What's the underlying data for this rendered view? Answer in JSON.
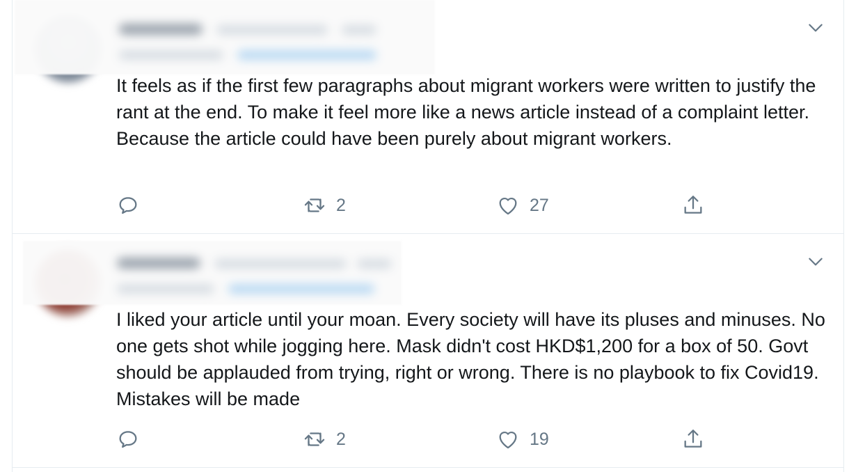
{
  "tweets": [
    {
      "text": "It feels as if the first few paragraphs about migrant workers were written to justify the rant at the end. To make it feel more like a news article instead of a complaint letter. Because the article could have been purely about migrant workers.",
      "retweets": "2",
      "likes": "27"
    },
    {
      "text": "I liked your article until your moan.  Every society will have its pluses and minuses. No one gets shot while jogging here. Mask didn't cost HKD$1,200 for a box of 50. Govt should be applauded from trying, right or wrong. There is no playbook to fix Covid19. Mistakes will be made",
      "retweets": "2",
      "likes": "19"
    }
  ],
  "icons": {
    "reply": "reply-icon",
    "retweet": "retweet-icon",
    "like": "heart-icon",
    "share": "share-icon",
    "more": "chevron-down-icon"
  },
  "colors": {
    "icon": "#657786",
    "border": "#e6ecf0",
    "text": "#14171a"
  }
}
